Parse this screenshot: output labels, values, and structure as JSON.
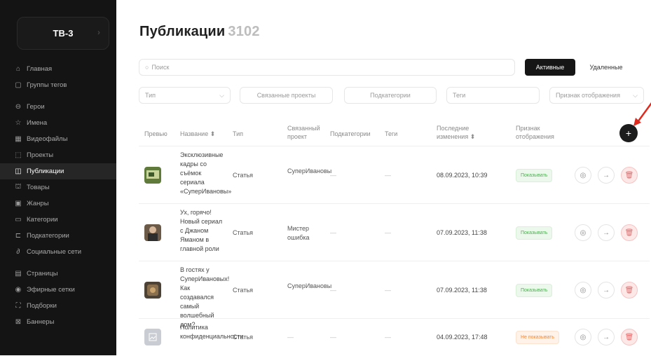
{
  "app": {
    "logo": "ТВ-3"
  },
  "sidebar": {
    "items": [
      {
        "label": "Главная",
        "icon": "home-icon"
      },
      {
        "label": "Группы тегов",
        "icon": "tag-group-icon"
      },
      {
        "label": "Герои",
        "icon": "heroes-icon"
      },
      {
        "label": "Имена",
        "icon": "star-icon"
      },
      {
        "label": "Видеофайлы",
        "icon": "video-icon"
      },
      {
        "label": "Проекты",
        "icon": "projects-icon"
      },
      {
        "label": "Публикации",
        "icon": "publications-icon",
        "active": true
      },
      {
        "label": "Товары",
        "icon": "goods-icon"
      },
      {
        "label": "Жанры",
        "icon": "genres-icon"
      },
      {
        "label": "Категории",
        "icon": "folder-icon"
      },
      {
        "label": "Подкатегории",
        "icon": "subfolder-icon"
      },
      {
        "label": "Социальные сети",
        "icon": "link-icon"
      },
      {
        "label": "Страницы",
        "icon": "pages-icon"
      },
      {
        "label": "Эфирные сетки",
        "icon": "broadcast-icon"
      },
      {
        "label": "Подборки",
        "icon": "collections-icon"
      },
      {
        "label": "Баннеры",
        "icon": "banner-icon"
      }
    ]
  },
  "page": {
    "title": "Публикации",
    "count": "3102"
  },
  "search": {
    "placeholder": "Поиск"
  },
  "tabs": {
    "active": "Активные",
    "deleted": "Удаленные"
  },
  "filters": {
    "type": "Тип",
    "projects": "Связанные проекты",
    "subcategories": "Подкатегории",
    "tags": "Теги",
    "display": "Признак отображения"
  },
  "table": {
    "headers": {
      "preview": "Превью",
      "name": "Название ⬍",
      "type": "Тип",
      "project": "Связанный проект",
      "subcategories": "Подкатегории",
      "tags": "Теги",
      "modified": "Последние изменения ⬍",
      "display": "Признак отображения"
    },
    "rows": [
      {
        "name": "Эксклюзивные кадры со съёмок сериала «СуперИвановы»",
        "type": "Статья",
        "project": "СуперИвановы",
        "subcategories": "—",
        "tags": "—",
        "modified": "08.09.2023, 10:39",
        "display": "Показывать",
        "thumb_color": "#5f7a3a"
      },
      {
        "name": "Ух, горячо! Новый сериал с Джаном Яманом в главной роли",
        "type": "Статья",
        "project": "Мистер ошибка",
        "subcategories": "—",
        "tags": "—",
        "modified": "07.09.2023, 11:38",
        "display": "Показывать",
        "thumb_color": "#6b5a47"
      },
      {
        "name": "В гостях у СуперИвановых! Как создавался самый волшебный дом?",
        "type": "Статья",
        "project": "СуперИвановы",
        "subcategories": "—",
        "tags": "—",
        "modified": "07.09.2023, 11:38",
        "display": "Показывать",
        "thumb_color": "#4d4236"
      },
      {
        "name": "Политика конфиденциальности",
        "type": "Статья",
        "project": "—",
        "subcategories": "—",
        "tags": "—",
        "modified": "04.09.2023, 17:48",
        "display": "Не показывать",
        "thumb_color": "#c9ccd2"
      }
    ]
  },
  "colors": {
    "accent": "#161616",
    "show": "#4caf50",
    "hide": "#f08a3c",
    "delete": "#e26a6a"
  }
}
